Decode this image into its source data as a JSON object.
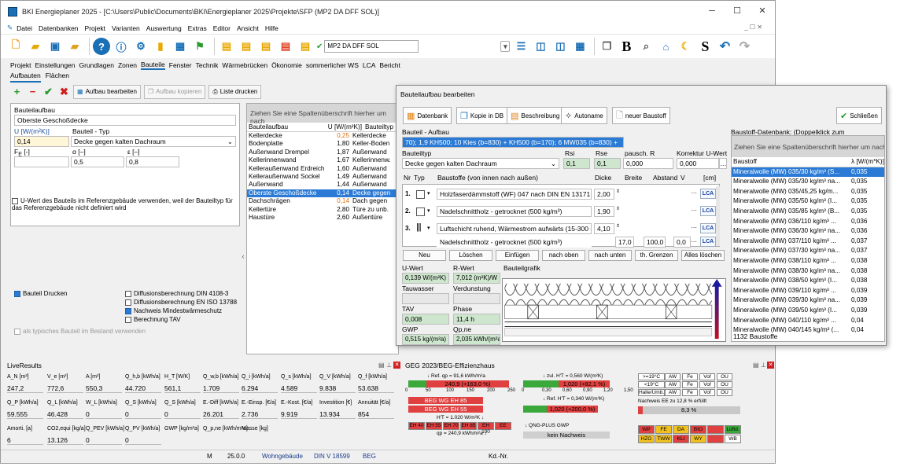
{
  "window": {
    "title": "BKI Energieplaner 2025 - [C:\\Users\\Public\\Documents\\BKI\\Energieplaner 2025\\Projekte\\SFP (MP2 DA DFF SOL)]",
    "controls": {
      "min": "─",
      "max": "☐",
      "close": "✕"
    }
  },
  "menu": {
    "items": [
      "Datei",
      "Datenbanken",
      "Projekt",
      "Varianten",
      "Auswertung",
      "Extras",
      "Editor",
      "Ansicht",
      "Hilfe"
    ],
    "mdi_controls": "_ ☐ ✕"
  },
  "toolbar": {
    "project_combo": "MP2 DA DFF SOL"
  },
  "main_tabs": [
    "Projekt",
    "Einstellungen",
    "Grundlagen",
    "Zonen",
    "Bauteile",
    "Fenster",
    "Technik",
    "Wärmebrücken",
    "Ökonomie",
    "sommerlicher WS",
    "LCA",
    "Bericht"
  ],
  "active_main_tab": "Bauteile",
  "sub_tabs": [
    "Aufbauten",
    "Flächen"
  ],
  "sub_toolbar": {
    "edit": "Aufbau bearbeiten",
    "copy": "Aufbau kopieren",
    "print": "Liste drucken"
  },
  "left": {
    "heading": "Bauteilaufbau",
    "name_value": "Oberste Geschoßdecke",
    "u_label": "U [W/(m²K)]",
    "typ_label": "Bauteil - Typ",
    "u_value": "0,14",
    "typ_value": "Decke gegen kalten Dachraum",
    "fe_label": "F",
    "fe_sub": "E",
    "fe_unit": "[-]",
    "alpha_label": "α [–]",
    "eps_label": "ε [–]",
    "alpha_value": "0,5",
    "eps_value": "0,8",
    "ref_note": "U-Wert des Bauteils im Referenzgebäude verwenden, weil der Bauteiltyp für das Referenzgebäude nicht definiert wird",
    "print_label": "Bauteil Drucken",
    "diff_din": "Diffusionsberechnung DIN 4108-3",
    "diff_en": "Diffusionsberechnung EN ISO 13788",
    "mindest": "Nachweis Mindestwärmeschutz",
    "tav": "Berechnung TAV",
    "typical": "als typisches Bauteil im Bestand verwenden"
  },
  "grid": {
    "group_hint": "Ziehen Sie eine Spaltenüberschrift hierher um nach",
    "headers": [
      "Bauteilaufbau",
      "U [W/(m²K)]",
      "Bauteiltyp"
    ],
    "rows": [
      {
        "name": "Kellerdecke",
        "u": "0,25",
        "typ": "Kellerdecke",
        "orange": true,
        "sel": false
      },
      {
        "name": "Bodenplatte",
        "u": "1,80",
        "typ": "Keller-Boden",
        "orange": false,
        "sel": false
      },
      {
        "name": "Außenwand Drempel",
        "u": "1,87",
        "typ": "Außenwand",
        "orange": false,
        "sel": false
      },
      {
        "name": "Kellerinnenwand",
        "u": "1,67",
        "typ": "Kellerinnenw.",
        "orange": false,
        "sel": false
      },
      {
        "name": "Kelleraußenwand Erdreich",
        "u": "1,60",
        "typ": "Außenwand",
        "orange": false,
        "sel": false
      },
      {
        "name": "Kelleraußenwand Sockel",
        "u": "1,49",
        "typ": "Außenwand",
        "orange": false,
        "sel": false
      },
      {
        "name": "Außenwand",
        "u": "1,44",
        "typ": "Außenwand",
        "orange": false,
        "sel": false
      },
      {
        "name": "Oberste Geschoßdecke",
        "u": "0,14",
        "typ": "Decke gegen",
        "orange": true,
        "sel": true
      },
      {
        "name": "Dachschrägen",
        "u": "0,14",
        "typ": "Dach gegen",
        "orange": true,
        "sel": false
      },
      {
        "name": "Kellertüre",
        "u": "2,80",
        "typ": "Türe zu unb.",
        "orange": false,
        "sel": false
      },
      {
        "name": "Haustüre",
        "u": "2,60",
        "typ": "Außentüre",
        "orange": false,
        "sel": false
      }
    ]
  },
  "dialog": {
    "title": "Bauteilaufbau bearbeiten",
    "buttons": [
      "Datenbank",
      "Kopie in DB",
      "Beschreibung",
      "Autoname",
      "neuer Baustoff"
    ],
    "close": "Schließen",
    "aufbau_label": "Bauteil - Aufbau",
    "aufbau_value": "70); 1,9 KH500; 10 Kies (b=830) + KH500 (b=170); 6 MW035 (b=830) +",
    "typ_label": "Bauteiltyp",
    "typ_value": "Decke gegen kalten Dachraum",
    "rsi_label": "Rsi",
    "rsi": "0,1",
    "rse_label": "Rse",
    "rse": "0,1",
    "pausch_label": "pausch. R",
    "pausch": "0,000",
    "korr_label": "Korrektur U-Wert",
    "korr": "0,000",
    "layer_headers": {
      "nr": "Nr",
      "typ": "Typ",
      "baustoffe": "Baustoffe (von innen nach außen)",
      "dicke": "Dicke",
      "breite": "Breite",
      "abstand": "Abstand",
      "v": "V",
      "cm": "[cm]"
    },
    "layers": [
      {
        "nr": "1.",
        "name": "Holzfaserdämmstoff (WF) 047 nach DIN EN 13171",
        "dicke": "2,00",
        "lca": "LCA"
      },
      {
        "nr": "2.",
        "name": "Nadelschnittholz - getrocknet (500 kg/m³)",
        "dicke": "1,90",
        "lca": "LCA"
      },
      {
        "nr": "3.",
        "name": "Luftschicht ruhend, Wärmestrom aufwärts (15-300 m",
        "dicke": "4,10",
        "lca": "LCA"
      },
      {
        "nr": "",
        "name": "Nadelschnittholz - getrocknet (500 kg/m³)",
        "dicke": "17,0",
        "breite": "100,0",
        "abstand": "0,0",
        "lca": "LCA"
      }
    ],
    "actions": [
      "Neu",
      "Löschen",
      "Einfügen",
      "nach oben",
      "nach unten",
      "th. Grenzen",
      "Alles löschen"
    ],
    "results": {
      "u_label": "U-Wert",
      "u_value": "0,139 W/(m²K)",
      "r_label": "R-Wert",
      "r_value": "7,012 (m²K)/W",
      "tau_label": "Tauwasser",
      "verd_label": "Verdunstung",
      "tav_label": "TAV",
      "tav_value": "0,008",
      "phase_label": "Phase",
      "phase_value": "11,4 h",
      "gwp_label": "GWP",
      "gwp_value": "0,515 kg/(m²a)",
      "qp_label": "Qp,ne",
      "qp_value": "2,035 kWh/(m²a)"
    },
    "graphic_label": "Bauteilgrafik",
    "db_title": "Baustoff-Datenbank: (Doppelklick zum Übernehmen)",
    "db_hint": "Ziehen Sie eine Spaltenüberschrift hierher um nach",
    "db_headers": [
      "Baustoff",
      "λ [W/(m*K)]"
    ],
    "db_rows": [
      {
        "n": "Mineralwolle (MW) 035/30 kg/m³ (S...",
        "l": "0,035",
        "sel": true
      },
      {
        "n": "Mineralwolle (MW) 035/30 kg/m³ na...",
        "l": "0,035",
        "sel": false
      },
      {
        "n": "Mineralwolle (MW) 035/45,25 kg/m...",
        "l": "0,035",
        "sel": false
      },
      {
        "n": "Mineralwolle (MW) 035/50 kg/m³ (I...",
        "l": "0,035",
        "sel": false
      },
      {
        "n": "Mineralwolle (MW) 035/85 kg/m³ (B...",
        "l": "0,035",
        "sel": false
      },
      {
        "n": "Mineralwolle (MW) 036/110 kg/m³ ...",
        "l": "0,036",
        "sel": false
      },
      {
        "n": "Mineralwolle (MW) 036/30 kg/m³ na...",
        "l": "0,036",
        "sel": false
      },
      {
        "n": "Mineralwolle (MW) 037/110 kg/m³ ...",
        "l": "0,037",
        "sel": false
      },
      {
        "n": "Mineralwolle (MW) 037/30 kg/m³ na...",
        "l": "0,037",
        "sel": false
      },
      {
        "n": "Mineralwolle (MW) 038/110 kg/m³ ...",
        "l": "0,038",
        "sel": false
      },
      {
        "n": "Mineralwolle (MW) 038/30 kg/m³ na...",
        "l": "0,038",
        "sel": false
      },
      {
        "n": "Mineralwolle (MW) 038/50 kg/m³ (I...",
        "l": "0,038",
        "sel": false
      },
      {
        "n": "Mineralwolle (MW) 039/110 kg/m³ ...",
        "l": "0,039",
        "sel": false
      },
      {
        "n": "Mineralwolle (MW) 039/30 kg/m³ na...",
        "l": "0,039",
        "sel": false
      },
      {
        "n": "Mineralwolle (MW) 039/50 kg/m³ (I...",
        "l": "0,039",
        "sel": false
      },
      {
        "n": "Mineralwolle (MW) 040/110 kg/m³ ...",
        "l": "0,04",
        "sel": false
      },
      {
        "n": "Mineralwolle (MW) 040/145 kg/m³ (...",
        "l": "0,04",
        "sel": false
      }
    ],
    "db_count": "1132 Baustoffe"
  },
  "live": {
    "title": "LiveResults",
    "row1_labels": [
      "A_N [m²]",
      "V_e [m³]",
      "A [m²]",
      "Q_h,b [kWh/a]",
      "H_T [W/K]",
      "Q_w,b [kWh/a]",
      "Q_i [kWh/a]",
      "Q_s [kWh/a]",
      "Q_V [kWh/a]",
      "Q_f [kWh/a]"
    ],
    "row1_values": [
      "247,2",
      "772,6",
      "550,3",
      "44.720",
      "561,1",
      "1.709",
      "6.294",
      "4.589",
      "9.838",
      "53.638"
    ],
    "row2_labels": [
      "Q_P [kWh/a]",
      "Q_L [kWh/a]",
      "W_L [kWh/a]",
      "Q_S [kWh/a]",
      "Q_S [kWh/a]",
      "E.-Diff [kWh/a]",
      "E.-Einsp. [€/a]",
      "E.-Kost. [€/a]",
      "Investition [€]",
      "Annuität [€/a]"
    ],
    "row2_values": [
      "59.555",
      "46.428",
      "0",
      "0",
      "0",
      "26.201",
      "2.736",
      "9.919",
      "13.934",
      "854"
    ],
    "row3_labels": [
      "Amorti. [a]",
      "CO2,equi [kg/a]",
      "Q_PEV [kWh/a]",
      "Q_PV [kWh/a]",
      "GWP [kg/m²a]",
      "Q_p,ne [kWh/m²a]",
      "Masse [kg]"
    ],
    "row3_values": [
      "6",
      "13.126",
      "0",
      "0"
    ]
  },
  "geg": {
    "title": "GEG 2023/BEG-Effizienzhaus",
    "ref_qp": "↓ Ref. qp = 91,6 kWh/m²a",
    "bar1": "240,9 (+163,0 %)",
    "scale1": [
      "0",
      "50",
      "100",
      "150",
      "200",
      "250"
    ],
    "beg85": "BEG WG EH 85",
    "beg55": "BEG WG EH 55",
    "ht": "H'T = 1.020 W/m²K ↓",
    "eh_boxes": [
      "EH 40",
      "EH 55",
      "EH 70",
      "EH 85",
      "EH 100",
      "EE"
    ],
    "qp_val": "qp = 240,9 kWh/m²a ↓",
    "zul": "↓ zul. H'T = 0,560 W/(m²K)",
    "bar2": "1,020 (+82,1 %)",
    "scale2": [
      "0",
      "0,30",
      "0,60",
      "0,90",
      "1,20",
      "1,50"
    ],
    "ref_ht": "↓ Ref. H'T = 0,340 W/(m²K)",
    "bar3": "1,020 (+200,0 %)",
    "qng": "↓ QNG-PLUS GWP",
    "kein": "kein Nachweis",
    "temp_rows": [
      [
        ">=19°C",
        "AW",
        "Fe",
        "Vof",
        "OU"
      ],
      [
        "<19°C",
        "AW",
        "Fe",
        "Vof",
        "OU"
      ],
      [
        "Halle/Umb.",
        "AW",
        "Fe",
        "Vof",
        "OU"
      ]
    ],
    "ee_note": "Nachweis EE zu 12,8 % erfüllt",
    "ee_pct": "8,3 %",
    "color_boxes_1": [
      "WP",
      "FE",
      "DA",
      "BIO",
      "",
      "Lüftd."
    ],
    "color_boxes_2": [
      "HZG",
      "TWW",
      "KLI",
      "WY",
      "",
      "WB"
    ]
  },
  "status": {
    "m": "M",
    "v": "25.0.0",
    "type": "Wohngebäude",
    "din": "DIN V 18599",
    "beg": "BEG",
    "kd": "Kd.-Nr."
  }
}
